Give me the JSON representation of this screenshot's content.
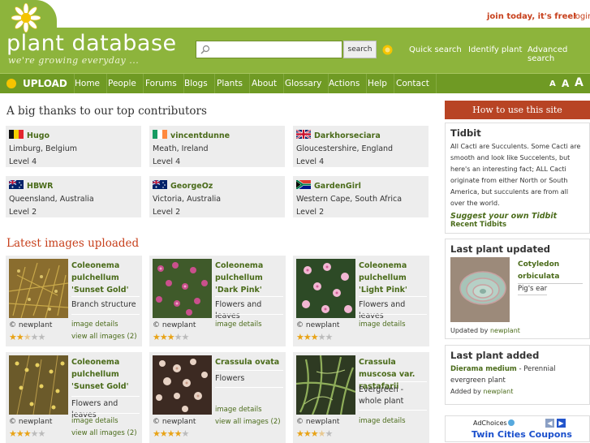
{
  "header": {
    "logo": "plant database",
    "tagline": "we're growing everyday ...",
    "join": "join today, it's free!",
    "login": "login",
    "search_placeholder": "",
    "search_button": "search",
    "links": [
      "Quick search",
      "Identify plant",
      "Advanced search"
    ]
  },
  "nav": {
    "upload": "UPLOAD",
    "items": [
      "Home",
      "People",
      "Forums",
      "Blogs",
      "Plants",
      "About",
      "Glossary",
      "Actions",
      "Help",
      "Contact"
    ],
    "font_sizes": [
      "A",
      "A",
      "A"
    ]
  },
  "contributors": {
    "heading": "A big thanks to our top contributors",
    "list": [
      {
        "name": "Hugo",
        "location": "Limburg, Belgium",
        "level": "Level 4",
        "flag": "belgium"
      },
      {
        "name": "vincentdunne",
        "location": "Meath, Ireland",
        "level": "Level 4",
        "flag": "ireland"
      },
      {
        "name": "Darkhorseciara",
        "location": "Gloucestershire, England",
        "level": "Level 4",
        "flag": "uk"
      },
      {
        "name": "HBWR",
        "location": "Queensland, Australia",
        "level": "Level 2",
        "flag": "australia"
      },
      {
        "name": "GeorgeOz",
        "location": "Victoria, Australia",
        "level": "Level 2",
        "flag": "australia"
      },
      {
        "name": "GardenGirl",
        "location": "Western Cape, South Africa",
        "level": "Level 2",
        "flag": "southafrica"
      }
    ]
  },
  "latest": {
    "heading": "Latest images uploaded",
    "cards": [
      {
        "title": "Coleonema pulchellum 'Sunset Gold'",
        "desc": "Branch structure",
        "credit": "© newplant",
        "rating": 2.5,
        "link1": "image details",
        "link2": "view all images (2)"
      },
      {
        "title": "Coleonema pulchellum 'Dark Pink'",
        "desc": "Flowers and leaves",
        "credit": "© newplant",
        "rating": 3,
        "link1": "image details",
        "link2": ""
      },
      {
        "title": "Coleonema pulchellum 'Light Pink'",
        "desc": "Flowers and leaves",
        "credit": "© newplant",
        "rating": 3,
        "link1": "image details",
        "link2": ""
      },
      {
        "title": "Coleonema pulchellum 'Sunset Gold'",
        "desc": "Flowers and leaves",
        "credit": "© newplant",
        "rating": 3,
        "link1": "image details",
        "link2": "view all images (2)"
      },
      {
        "title": "Crassula ovata",
        "desc": "Flowers",
        "credit": "© newplant",
        "rating": 4,
        "link1": "image details",
        "link2": "view all images (2)"
      },
      {
        "title": "Crassula muscosa var. rastafarii",
        "desc": "Evergreen - whole plant",
        "credit": "© newplant",
        "rating": 3.5,
        "link1": "image details",
        "link2": ""
      }
    ]
  },
  "sidebar": {
    "howto": "How to use this site",
    "tidbit": {
      "title": "Tidbit",
      "text": "All Cacti are Succulents. Some Cacti are smooth and look like Succelents, but here's an interesting fact; ALL Cacti originate from either North or South America, but succulents are from all over the world.",
      "suggest": "Suggest your own Tidbit",
      "recent": "Recent Tidbits"
    },
    "updated": {
      "title": "Last plant updated",
      "plant": "Cotyledon orbiculata",
      "common": "Pig's ear",
      "by_label": "Updated by",
      "by": "newplant"
    },
    "added": {
      "title": "Last plant added",
      "plant": "Dierama medium",
      "desc": " - Perennial evergreen plant",
      "by_label": "Added by",
      "by": "newplant"
    },
    "ad": {
      "choices": "AdChoices",
      "text": "Twin Cities Coupons"
    }
  },
  "colors": {
    "green": "#8db43c",
    "nav": "#6f9a24",
    "orange": "#c7401c",
    "howto": "#b84424"
  }
}
